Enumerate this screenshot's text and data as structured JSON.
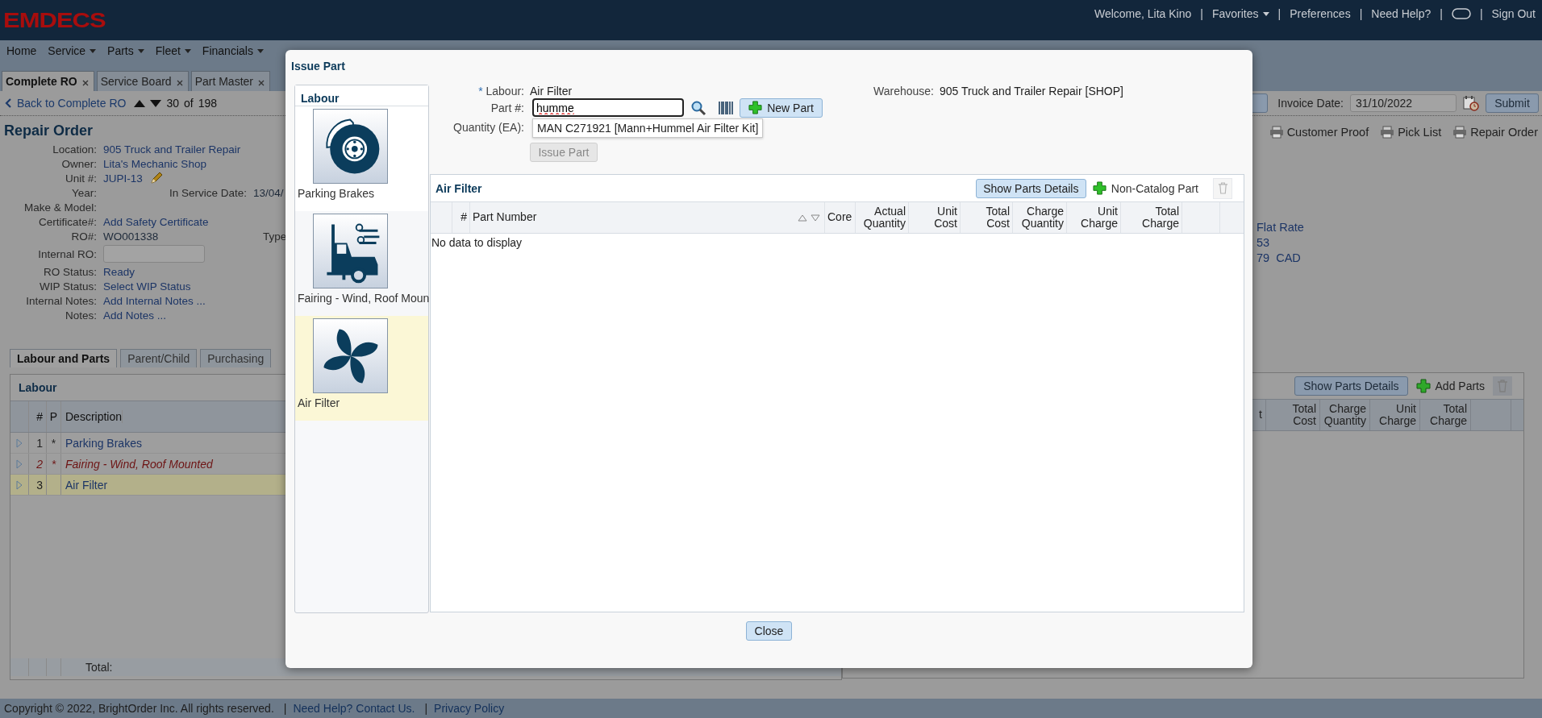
{
  "header": {
    "logo": "EMDECS",
    "separator": "|",
    "items": [
      {
        "kind": "text",
        "label": "Welcome, Lita Kino"
      },
      {
        "kind": "menu",
        "label": "Favorites"
      },
      {
        "kind": "link",
        "label": "Preferences"
      },
      {
        "kind": "link",
        "label": "Need Help?"
      },
      {
        "kind": "toggle"
      },
      {
        "kind": "link",
        "label": "Sign Out"
      }
    ]
  },
  "menu": [
    {
      "label": "Home",
      "dropdown": false
    },
    {
      "label": "Service",
      "dropdown": true
    },
    {
      "label": "Parts",
      "dropdown": true
    },
    {
      "label": "Fleet",
      "dropdown": true
    },
    {
      "label": "Financials",
      "dropdown": true
    }
  ],
  "page_tabs": [
    {
      "label": "Complete RO",
      "selected": true
    },
    {
      "label": "Service Board",
      "selected": false
    },
    {
      "label": "Part Master",
      "selected": false
    }
  ],
  "toolbar": {
    "back": "Back to Complete RO",
    "record": "30",
    "of": "of",
    "total": "198",
    "invoice_label": "Invoice Date:",
    "invoice_date": "31/10/2022",
    "submit": "Submit"
  },
  "repair_order": {
    "title": "Repair Order",
    "fields": [
      {
        "label": "Location:",
        "kind": "link",
        "value": "905 Truck and Trailer Repair"
      },
      {
        "label": "Owner:",
        "kind": "link",
        "value": "Lita's Mechanic Shop"
      },
      {
        "label": "Unit #:",
        "kind": "edit",
        "value": "JUPI-13"
      },
      {
        "label": "Year:",
        "kind": "text",
        "extra_label": "In Service Date:",
        "extra_value": "13/04/"
      },
      {
        "label": "Make & Model:",
        "kind": "text"
      },
      {
        "label": "Certificate#:",
        "kind": "link",
        "value": "Add Safety Certificate"
      },
      {
        "label": "RO#:",
        "kind": "text",
        "value": "WO001338",
        "extra_label": "Type"
      },
      {
        "label": "Internal RO:",
        "kind": "input"
      },
      {
        "label": "RO Status:",
        "kind": "link",
        "value": "Ready"
      },
      {
        "label": "WIP Status:",
        "kind": "link",
        "value": "Select WIP Status"
      },
      {
        "label": "Internal Notes:",
        "kind": "link",
        "value": "Add Internal Notes ..."
      },
      {
        "label": "Notes:",
        "kind": "link",
        "value": "Add Notes ..."
      }
    ]
  },
  "print_links": [
    "Customer Proof",
    "Pick List",
    "Repair Order"
  ],
  "summary": [
    "Flat Rate",
    "53",
    "79  CAD"
  ],
  "lower_tabs": [
    {
      "label": "Labour and Parts",
      "selected": true
    },
    {
      "label": "Parent/Child",
      "selected": false
    },
    {
      "label": "Purchasing",
      "selected": false
    }
  ],
  "labour_table": {
    "title": "Labour",
    "columns": [
      "#",
      "P",
      "Description"
    ],
    "rows": [
      {
        "num": "1",
        "priority": "*",
        "description": "Parking Brakes",
        "flagged": false,
        "selected": false
      },
      {
        "num": "2",
        "priority": "*",
        "description": "Fairing - Wind, Roof Mounted",
        "flagged": true,
        "selected": false
      },
      {
        "num": "3",
        "description": "Air Filter",
        "flagged": false,
        "selected": true
      }
    ],
    "total_label": "Total:"
  },
  "parts_panel": {
    "show_details": "Show Parts Details",
    "add": "Add Parts",
    "delete_disabled": true,
    "columns": [
      "t",
      "Total Cost",
      "Charge Quantity",
      "Unit Charge",
      "Total Charge"
    ]
  },
  "footer": {
    "copyright": "Copyright © 2022, BrightOrder Inc. All rights reserved.",
    "separator": "|",
    "links": [
      "Need Help? Contact Us.",
      "Privacy Policy"
    ]
  },
  "dialog": {
    "title": "Issue Part",
    "labour_list": {
      "title": "Labour",
      "items": [
        {
          "label": "Parking Brakes",
          "kind": "brake",
          "selected": false
        },
        {
          "label": "Fairing - Wind, Roof Moun",
          "kind": "truck",
          "selected": false
        },
        {
          "label": "Air Filter",
          "kind": "fan",
          "selected": true
        }
      ]
    },
    "form": {
      "required_mark": "*",
      "labour_label": "Labour:",
      "labour_value": "Air Filter",
      "part_label": "Part #:",
      "part_value": "humme",
      "new_part": "New Part",
      "suggestion": "MAN C271921 [Mann+Hummel Air Filter Kit]",
      "quantity_label": "Quantity (EA):",
      "issue_button": {
        "label": "Issue Part",
        "disabled": true
      },
      "warehouse_label": "Warehouse:",
      "warehouse_value": "905 Truck and Trailer Repair [SHOP]"
    },
    "grid": {
      "title": "Air Filter",
      "show_details": "Show Parts Details",
      "non_catalog": "Non-Catalog Part",
      "delete_disabled": true,
      "columns": [
        {
          "label": "#",
          "kind": "number"
        },
        {
          "label": "Part Number",
          "kind": "text",
          "sortable": true
        },
        {
          "label": "Core",
          "kind": "text"
        },
        {
          "label": "Actual Quantity",
          "kind": "number"
        },
        {
          "label": "Unit Cost",
          "kind": "number"
        },
        {
          "label": "Total Cost",
          "kind": "number"
        },
        {
          "label": "Charge Quantity",
          "kind": "number"
        },
        {
          "label": "Unit Charge",
          "kind": "number"
        },
        {
          "label": "Total Charge",
          "kind": "number"
        }
      ],
      "empty_text": "No data to display"
    },
    "close": "Close"
  }
}
